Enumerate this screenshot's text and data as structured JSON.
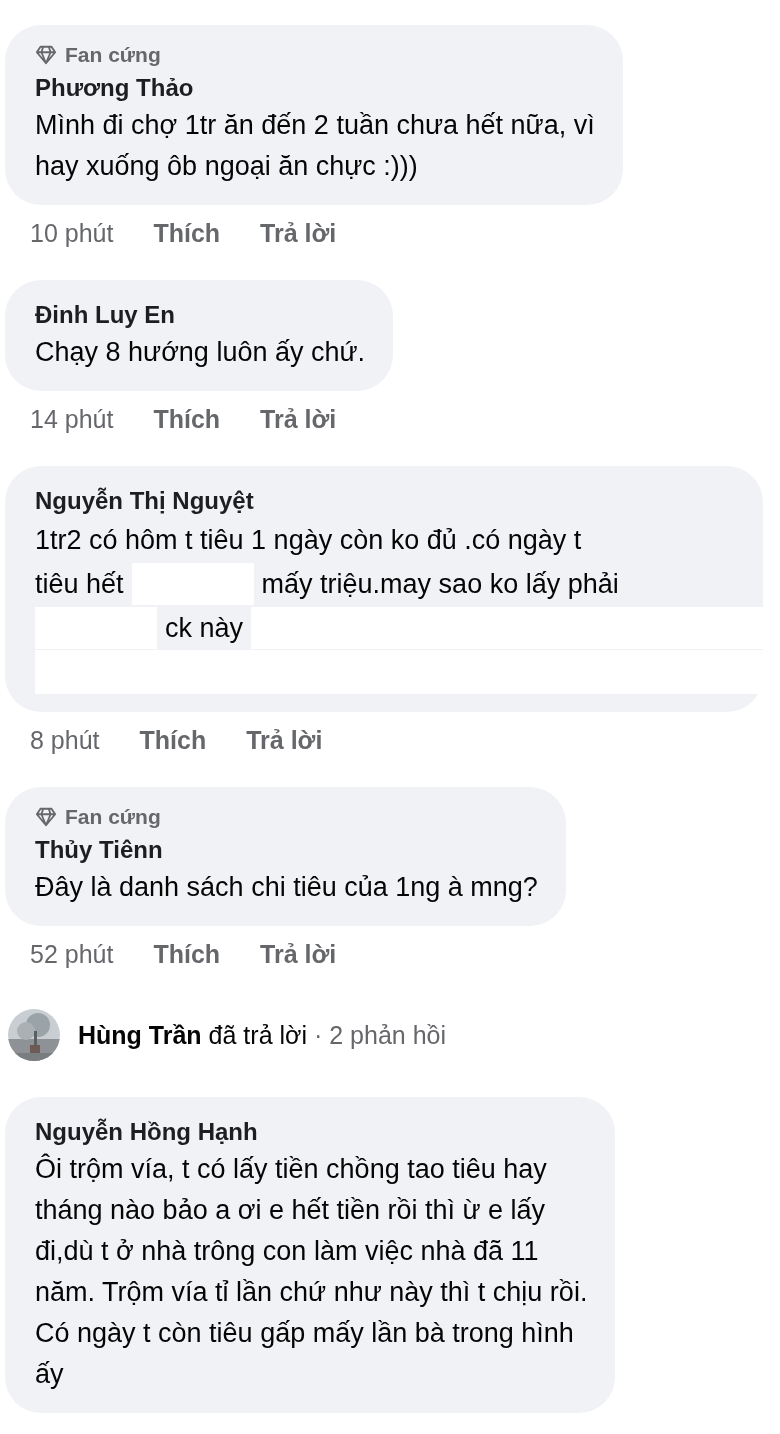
{
  "comments": [
    {
      "kind": "comment",
      "badge": "Fan cứng",
      "author": "Phương Thảo",
      "text": "Mình đi chợ 1tr ăn đến 2 tuần chưa hết nữa, vì\nhay xuống ôb ngoại ăn chực :)))",
      "time": "10 phút",
      "like": "Thích",
      "reply": "Trả lời"
    },
    {
      "kind": "comment",
      "author": "Đinh Luy En",
      "text": "Chạy 8 hướng luôn ấy chứ.",
      "time": "14 phút",
      "like": "Thích",
      "reply": "Trả lời"
    },
    {
      "kind": "comment",
      "author": "Nguyễn Thị Nguyệt",
      "lines": [
        [
          {
            "kind": "text",
            "text": "1tr2 có hôm t tiêu 1 ngày còn ko đủ .có ngày t"
          }
        ],
        [
          {
            "kind": "text",
            "text": "tiêu hết"
          },
          {
            "kind": "redacted"
          },
          {
            "kind": "text",
            "text": "mấy triệu.may sao ko lấy phải"
          }
        ],
        [
          {
            "kind": "redacted"
          },
          {
            "kind": "text",
            "text": "ck này"
          },
          {
            "kind": "redacted"
          }
        ],
        [
          {
            "kind": "redacted"
          }
        ]
      ],
      "time": "8 phút",
      "like": "Thích",
      "reply": "Trả lời"
    },
    {
      "kind": "comment",
      "badge": "Fan cứng",
      "author": "Thủy Tiênn",
      "text": "Đây là danh sách chi tiêu của 1ng à mng?",
      "time": "52 phút",
      "like": "Thích",
      "reply": "Trả lời"
    },
    {
      "kind": "replies",
      "author": "Hùng Trần",
      "action": "đã trả lời",
      "count": "· 2 phản hồi"
    },
    {
      "kind": "comment",
      "author": "Nguyễn Hồng Hạnh",
      "text": "Ôi trộm vía, t có lấy tiền chồng tao tiêu hay\ntháng nào bảo a ơi e hết tiền rồi thì ừ e lấy\nđi,dù t ở nhà trông con làm việc nhà đã 11\nnăm. Trộm vía tỉ lần chứ như này thì t chịu rồi.\nCó ngày t còn tiêu gấp mấy lần bà trong hình\nấy"
    }
  ]
}
